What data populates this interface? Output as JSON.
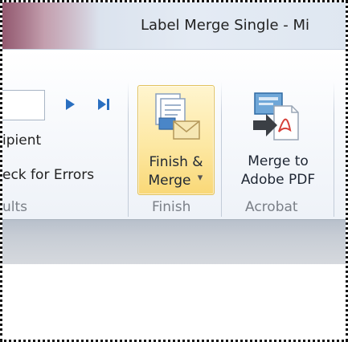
{
  "window": {
    "title": "Label Merge Single - Mi"
  },
  "preview_group": {
    "recipient_text": "ipient",
    "check_errors_text": "eck for Errors",
    "group_label": "ults"
  },
  "finish_group": {
    "button_line1": "Finish &",
    "button_line2": "Merge",
    "dropdown_arrow": "▾",
    "group_label": "Finish"
  },
  "acrobat_group": {
    "button_line1": "Merge to",
    "button_line2": "Adobe PDF",
    "group_label": "Acrobat"
  },
  "icons": {
    "next": "next-record-icon",
    "last": "last-record-icon",
    "finish": "finish-merge-icon",
    "pdf": "merge-to-pdf-icon"
  },
  "colors": {
    "title_accent": "#6f2240",
    "button_highlight": "#fde8a3",
    "nav_arrow": "#2a6fc0"
  }
}
